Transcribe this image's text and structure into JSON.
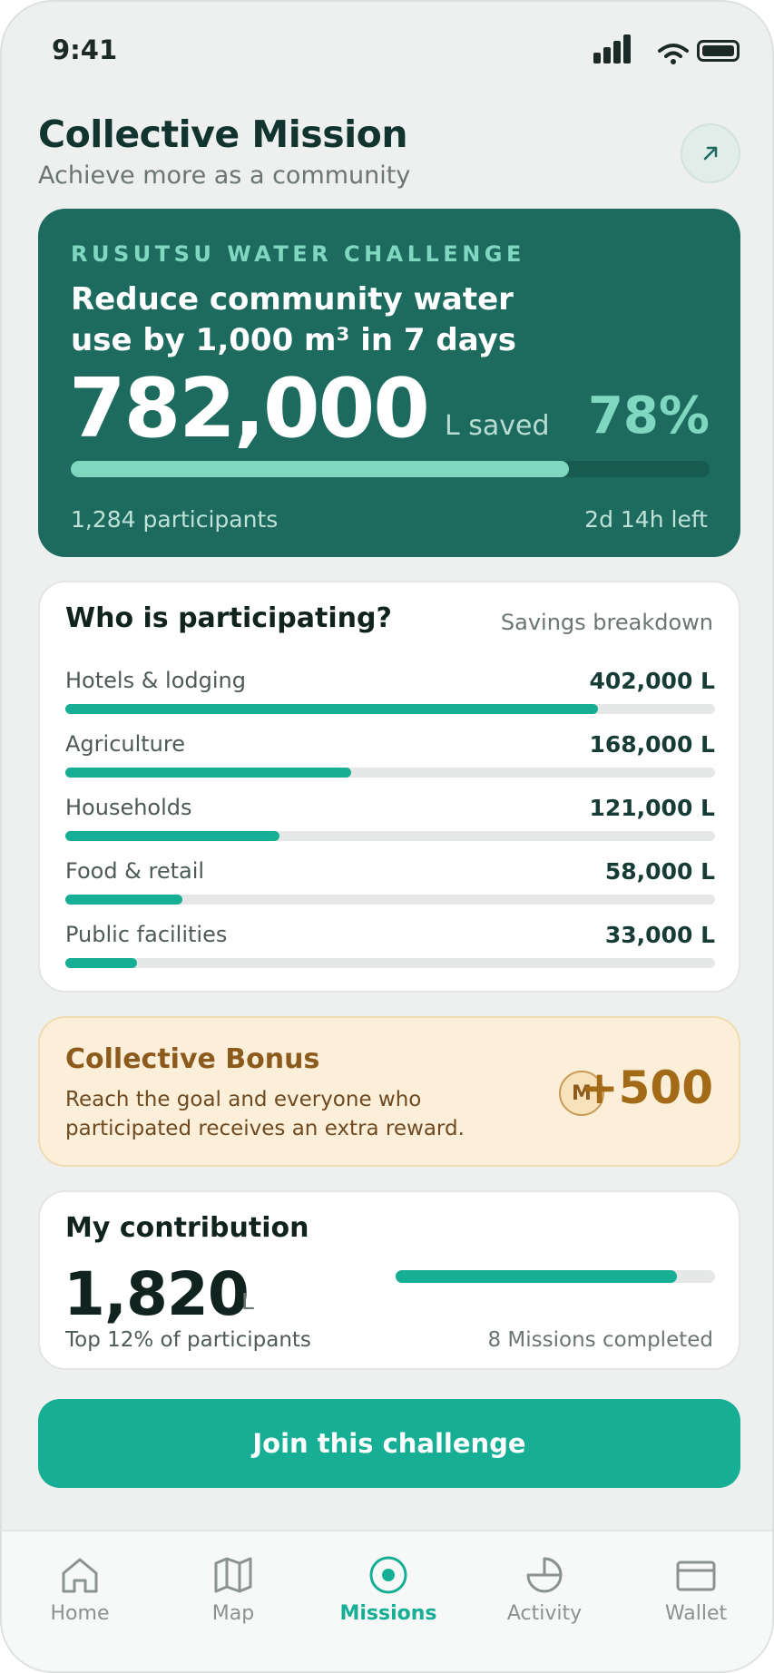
{
  "status_bar": {
    "time": "9:41"
  },
  "header": {
    "title": "Collective Mission",
    "subtitle": "Achieve more as a community",
    "share_icon": "arrow-up-right-icon"
  },
  "challenge": {
    "eyebrow": "RUSUTSU WATER CHALLENGE",
    "goal": "Reduce community water use by 1,000 m³ in 7 days",
    "saved_value": "782,000",
    "saved_unit": "L saved",
    "percent_label": "78%",
    "progress": 0.78,
    "participants": "1,284 participants",
    "time_left": "2d 14h left",
    "accent_color": "#7fd7bf",
    "background_color": "#1d6b5f"
  },
  "participation": {
    "title": "Who is participating?",
    "link": "Savings breakdown",
    "rows": [
      {
        "label": "Hotels & lodging",
        "value": "402,000 L",
        "share": 0.82
      },
      {
        "label": "Agriculture",
        "value": "168,000 L",
        "share": 0.44
      },
      {
        "label": "Households",
        "value": "121,000 L",
        "share": 0.33
      },
      {
        "label": "Food & retail",
        "value": "58,000 L",
        "share": 0.18
      },
      {
        "label": "Public facilities",
        "value": "33,000 L",
        "share": 0.11
      }
    ]
  },
  "bonus": {
    "title": "Collective Bonus",
    "description": "Reach the goal and everyone who participated receives an extra reward.",
    "coin_symbol": "M",
    "amount": "+500"
  },
  "contribution": {
    "title": "My contribution",
    "value": "1,820",
    "unit": "L",
    "rank": "Top 12% of participants",
    "missions": "8 Missions completed",
    "progress": 0.88
  },
  "cta": {
    "label": "Join this challenge",
    "color": "#16ae94"
  },
  "nav": {
    "items": [
      {
        "label": "Home",
        "icon": "home-icon",
        "active": false
      },
      {
        "label": "Map",
        "icon": "map-icon",
        "active": false
      },
      {
        "label": "Missions",
        "icon": "target-icon",
        "active": true
      },
      {
        "label": "Activity",
        "icon": "pie-chart-icon",
        "active": false
      },
      {
        "label": "Wallet",
        "icon": "wallet-icon",
        "active": false
      }
    ]
  }
}
